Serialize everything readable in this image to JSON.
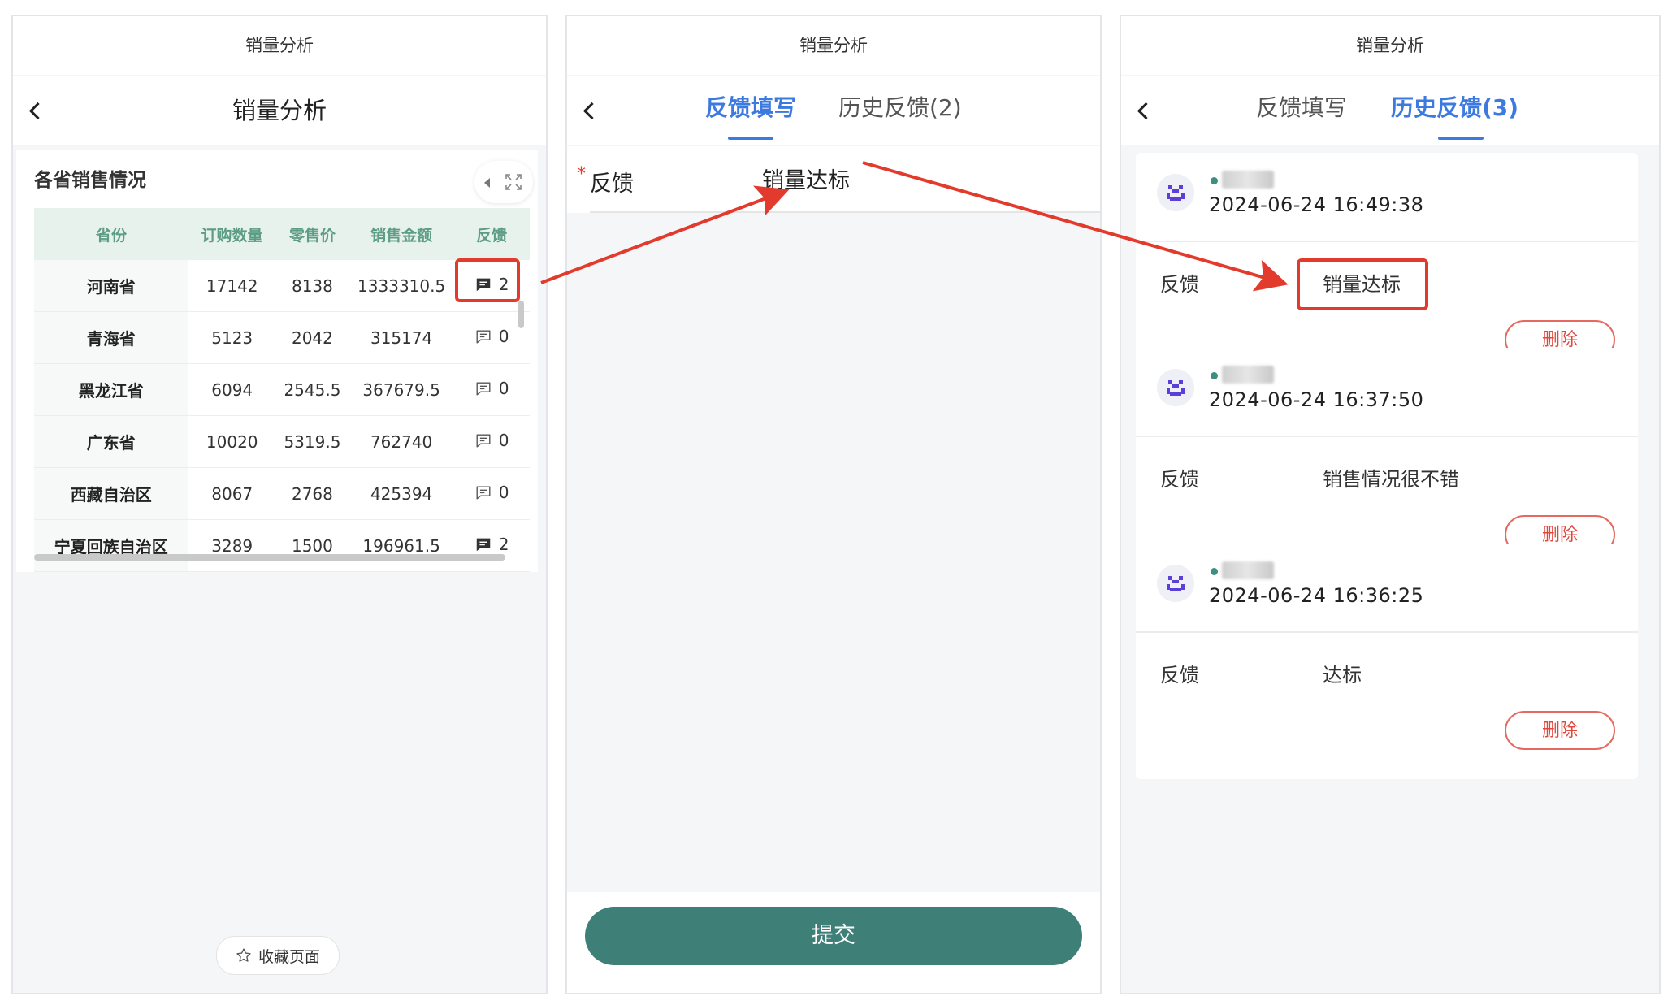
{
  "panel1": {
    "system_title": "销量分析",
    "nav_title": "销量分析",
    "card_title": "各省销售情况",
    "columns": [
      "省份",
      "订购数量",
      "零售价",
      "销售金额",
      "反馈"
    ],
    "rows": [
      {
        "province": "河南省",
        "qty": "17142",
        "price": "8138",
        "amount": "1333310.5",
        "feedback": "2",
        "has_feedback": true
      },
      {
        "province": "青海省",
        "qty": "5123",
        "price": "2042",
        "amount": "315174",
        "feedback": "0",
        "has_feedback": false
      },
      {
        "province": "黑龙江省",
        "qty": "6094",
        "price": "2545.5",
        "amount": "367679.5",
        "feedback": "0",
        "has_feedback": false
      },
      {
        "province": "广东省",
        "qty": "10020",
        "price": "5319.5",
        "amount": "762740",
        "feedback": "0",
        "has_feedback": false
      },
      {
        "province": "西藏自治区",
        "qty": "8067",
        "price": "2768",
        "amount": "425394",
        "feedback": "0",
        "has_feedback": false
      },
      {
        "province": "宁夏回族自治区",
        "qty": "3289",
        "price": "1500",
        "amount": "196961.5",
        "feedback": "2",
        "has_feedback": true
      }
    ],
    "favorite_label": "收藏页面"
  },
  "panel2": {
    "system_title": "销量分析",
    "tabs": [
      {
        "label": "反馈填写",
        "active": true
      },
      {
        "label": "历史反馈(2)",
        "active": false
      }
    ],
    "form": {
      "required_mark": "*",
      "label": "反馈",
      "value": "销量达标"
    },
    "submit_label": "提交"
  },
  "panel3": {
    "system_title": "销量分析",
    "tabs": [
      {
        "label": "反馈填写",
        "active": false
      },
      {
        "label": "历史反馈(3)",
        "active": true
      }
    ],
    "history": [
      {
        "time": "2024-06-24 16:49:38",
        "label": "反馈",
        "value": "销量达标",
        "delete_label": "删除"
      },
      {
        "time": "2024-06-24 16:37:50",
        "label": "反馈",
        "value": "销售情况很不错",
        "delete_label": "删除"
      },
      {
        "time": "2024-06-24 16:36:25",
        "label": "反馈",
        "value": "达标",
        "delete_label": "删除"
      }
    ]
  },
  "colors": {
    "accent_blue": "#3d7ae0",
    "submit_green": "#3e7f78",
    "table_header_bg": "#e7f2ec",
    "table_header_text": "#5d9d84",
    "delete_red": "#e0483d",
    "highlight_red": "#e33a2e"
  }
}
